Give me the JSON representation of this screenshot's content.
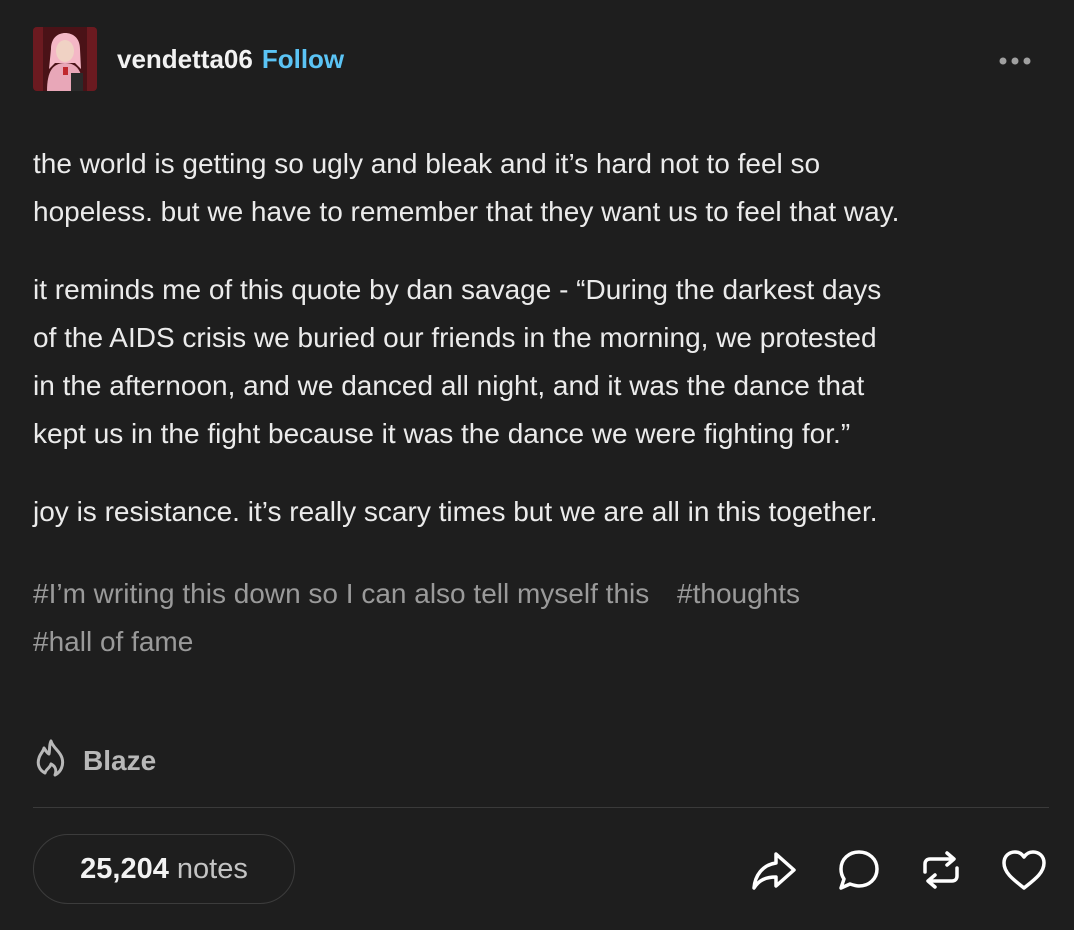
{
  "post": {
    "username": "vendetta06",
    "follow_label": "Follow",
    "paragraphs": [
      "the world is getting so ugly and bleak and it’s hard not to feel so\nhopeless. but we have to remember that they want us to feel that way.",
      "it reminds me of this quote by dan savage - “During the darkest days\nof the AIDS crisis we buried our friends in the morning, we protested\nin the afternoon, and we danced all night, and it was the dance that\nkept us in the fight because it was the dance we were fighting for.”",
      "joy is resistance. it’s really scary times but we are all in this together."
    ],
    "tags": [
      "#I’m writing this down so I can also tell myself this",
      "#thoughts",
      "#hall of fame"
    ],
    "blaze_label": "Blaze",
    "notes_count": "25,204",
    "notes_label": "notes"
  },
  "icons": {
    "more": "more-horizontal-icon",
    "blaze": "flame-icon",
    "share": "share-arrow-icon",
    "reply": "speech-bubble-icon",
    "reblog": "reblog-icon",
    "like": "heart-icon"
  },
  "colors": {
    "background": "#1e1e1e",
    "text": "#ebebeb",
    "follow": "#5bc4f5",
    "tags": "#9a9a9a"
  }
}
